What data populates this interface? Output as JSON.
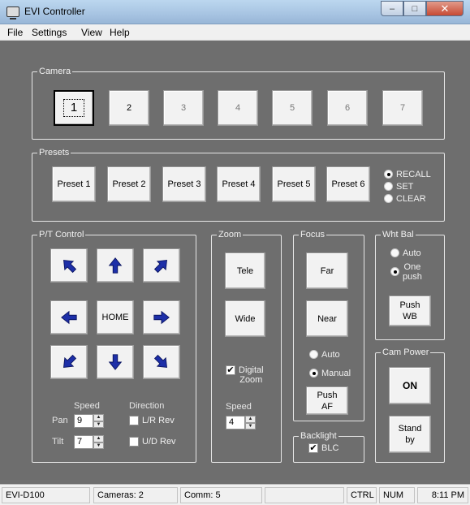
{
  "window": {
    "title": "EVI Controller"
  },
  "menu": [
    "File",
    "Settings",
    "View",
    "Help"
  ],
  "camera": {
    "label": "Camera",
    "buttons": [
      "1",
      "2",
      "3",
      "4",
      "5",
      "6",
      "7"
    ]
  },
  "presets": {
    "label": "Presets",
    "buttons": [
      "Preset 1",
      "Preset 2",
      "Preset 3",
      "Preset 4",
      "Preset 5",
      "Preset 6"
    ],
    "modes": [
      "RECALL",
      "SET",
      "CLEAR"
    ],
    "selected_mode": "RECALL"
  },
  "pt": {
    "label": "P/T Control",
    "home": "HOME",
    "speed": "Speed",
    "direction": "Direction",
    "pan": "Pan",
    "pan_value": "9",
    "tilt": "Tilt",
    "tilt_value": "7",
    "lr_rev": "L/R Rev",
    "ud_rev": "U/D Rev"
  },
  "zoom": {
    "label": "Zoom",
    "tele": "Tele",
    "wide": "Wide",
    "digital_line1": "Digital",
    "digital_line2": "Zoom",
    "digital_checked": true,
    "speed": "Speed",
    "speed_value": "4"
  },
  "focus": {
    "label": "Focus",
    "far": "Far",
    "near": "Near",
    "auto": "Auto",
    "manual": "Manual",
    "selected": "Manual",
    "push_af_line1": "Push",
    "push_af_line2": "AF"
  },
  "backlight": {
    "label": "Backlight",
    "blc": "BLC",
    "checked": true
  },
  "whtbal": {
    "label": "Wht Bal",
    "auto": "Auto",
    "one_line1": "One",
    "one_line2": "push",
    "selected": "One push",
    "push_wb_line1": "Push",
    "push_wb_line2": "WB"
  },
  "campower": {
    "label": "Cam Power",
    "on": "ON",
    "standby_line1": "Stand",
    "standby_line2": "by"
  },
  "status": {
    "model": "EVI-D100",
    "cameras": "Cameras:  2",
    "comm": "Comm:  5",
    "blank": "",
    "ctrl": "CTRL",
    "num": "NUM",
    "time": "8:11 PM"
  }
}
